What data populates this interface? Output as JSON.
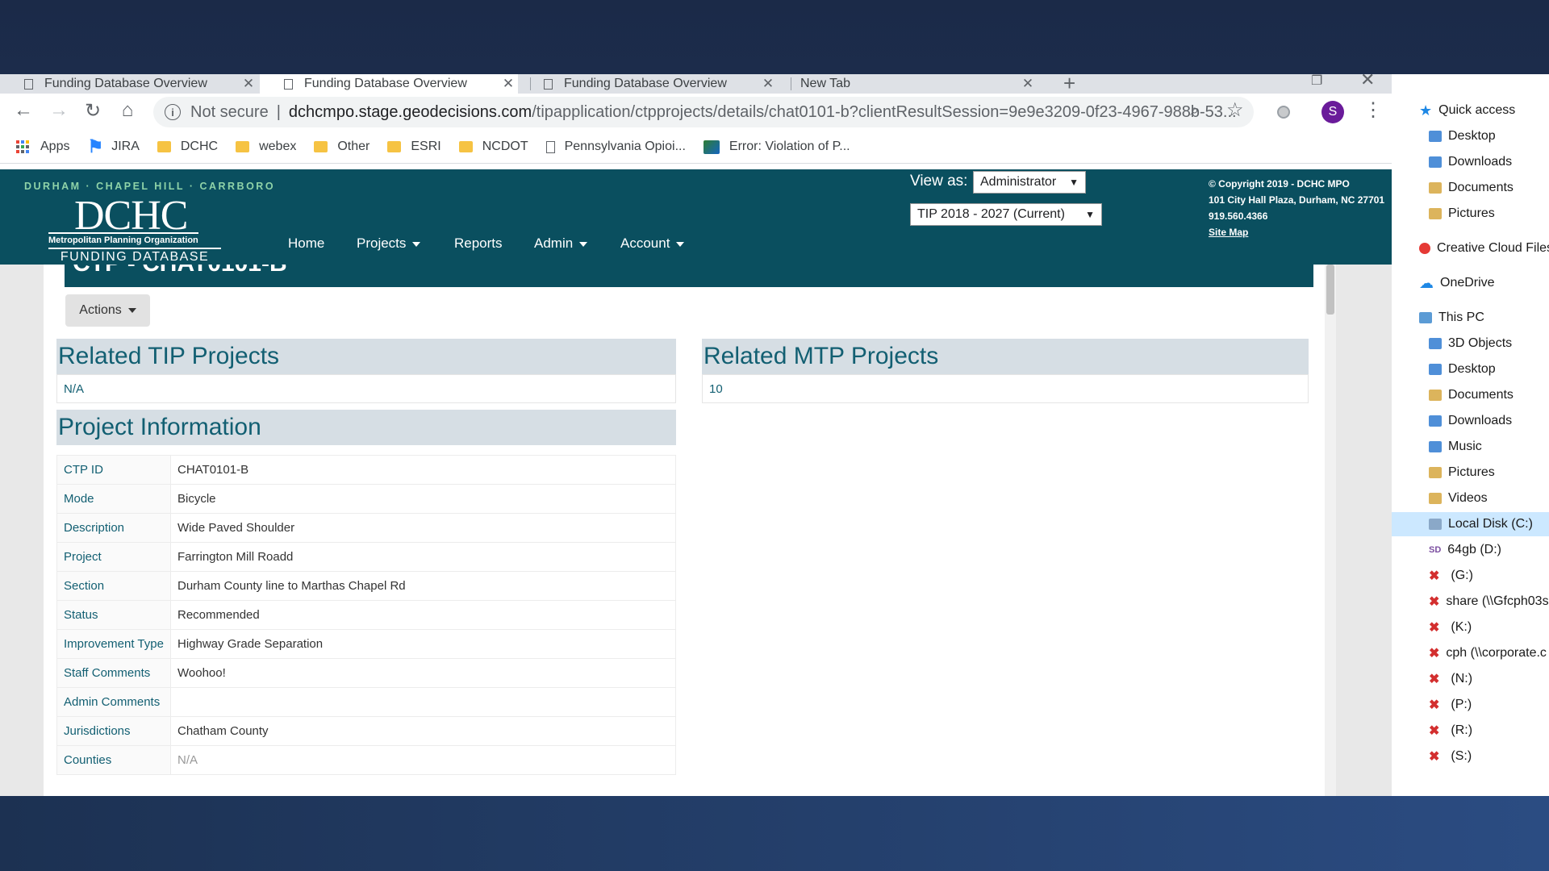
{
  "browser": {
    "tabs": [
      {
        "title": "Funding Database Overview",
        "close": "✕"
      },
      {
        "title": "Funding Database Overview",
        "close": "✕"
      },
      {
        "title": "Funding Database Overview",
        "close": "✕"
      },
      {
        "title": "New Tab",
        "close": "✕"
      }
    ],
    "new_tab": "+",
    "not_secure": "Not secure",
    "url_host": "dchcmpo.stage.geodecisions.com",
    "url_path": "/tipapplication/ctpprojects/details/chat0101-b?clientResultSession=9e9e3209-0f23-4967-988b-53...",
    "profile_initial": "S",
    "bookmarks": [
      {
        "label": "Apps",
        "icon": "apps-icon"
      },
      {
        "label": "JIRA",
        "icon": "jira-icon"
      },
      {
        "label": "DCHC",
        "icon": "folder-icon"
      },
      {
        "label": "webex",
        "icon": "folder-icon"
      },
      {
        "label": "Other",
        "icon": "folder-icon"
      },
      {
        "label": "ESRI",
        "icon": "folder-icon"
      },
      {
        "label": "NCDOT",
        "icon": "folder-icon"
      },
      {
        "label": "Pennsylvania Opioi...",
        "icon": "page-icon"
      },
      {
        "label": "Error: Violation of P...",
        "icon": "map-icon"
      }
    ]
  },
  "site": {
    "tagline": "DURHAM · CHAPEL HILL · CARRBORO",
    "logo": "DCHC",
    "logo_sub": "Metropolitan Planning Organization",
    "logo_title": "FUNDING DATABASE",
    "nav": [
      {
        "label": "Home",
        "dropdown": false
      },
      {
        "label": "Projects",
        "dropdown": true
      },
      {
        "label": "Reports",
        "dropdown": false
      },
      {
        "label": "Admin",
        "dropdown": true
      },
      {
        "label": "Account",
        "dropdown": true
      }
    ],
    "view_as_label": "View as:",
    "view_as_value": "Administrator",
    "tip_value": "TIP 2018 - 2027 (Current)",
    "copyright": "© Copyright 2019 - DCHC MPO",
    "address": "101 City Hall Plaza, Durham, NC 27701",
    "phone": "919.560.4366",
    "site_map": "Site Map"
  },
  "page": {
    "title": "CTP - CHAT0101-B",
    "actions_label": "Actions",
    "related_tip_title": "Related TIP Projects",
    "related_tip_value": "N/A",
    "related_mtp_title": "Related MTP Projects",
    "related_mtp_value": "10",
    "project_info_title": "Project Information",
    "project_info": [
      {
        "key": "CTP ID",
        "value": "CHAT0101-B"
      },
      {
        "key": "Mode",
        "value": "Bicycle"
      },
      {
        "key": "Description",
        "value": "Wide Paved Shoulder"
      },
      {
        "key": "Project",
        "value": "Farrington Mill Roadd"
      },
      {
        "key": "Section",
        "value": "Durham County line to Marthas Chapel Rd"
      },
      {
        "key": "Status",
        "value": "Recommended"
      },
      {
        "key": "Improvement Type",
        "value": "Highway Grade Separation"
      },
      {
        "key": "Staff Comments",
        "value": "Woohoo!"
      },
      {
        "key": "Admin Comments",
        "value": ""
      },
      {
        "key": "Jurisdictions",
        "value": "Chatham County"
      },
      {
        "key": "Counties",
        "value": "N/A"
      }
    ]
  },
  "explorer": {
    "items": [
      {
        "label": "Quick access",
        "icon": "star-icon"
      },
      {
        "label": "Desktop",
        "icon": "folder-icon"
      },
      {
        "label": "Downloads",
        "icon": "folder-icon"
      },
      {
        "label": "Documents",
        "icon": "folder-icon"
      },
      {
        "label": "Pictures",
        "icon": "folder-icon"
      },
      {
        "label": "Creative Cloud Files",
        "icon": "creative-cloud-icon"
      },
      {
        "label": "OneDrive",
        "icon": "cloud-icon"
      },
      {
        "label": "This PC",
        "icon": "pc-icon"
      },
      {
        "label": "3D Objects",
        "icon": "folder-icon"
      },
      {
        "label": "Desktop",
        "icon": "folder-icon"
      },
      {
        "label": "Documents",
        "icon": "folder-icon"
      },
      {
        "label": "Downloads",
        "icon": "folder-icon"
      },
      {
        "label": "Music",
        "icon": "folder-icon"
      },
      {
        "label": "Pictures",
        "icon": "folder-icon"
      },
      {
        "label": "Videos",
        "icon": "folder-icon"
      },
      {
        "label": "Local Disk (C:)",
        "icon": "disk-icon"
      },
      {
        "label": "64gb (D:)",
        "icon": "sd-card-icon"
      },
      {
        "label": "(G:)",
        "icon": "network-drive-disconnected-icon"
      },
      {
        "label": "share (\\\\Gfcph03s",
        "icon": "network-drive-disconnected-icon"
      },
      {
        "label": "(K:)",
        "icon": "network-drive-disconnected-icon"
      },
      {
        "label": "cph (\\\\corporate.c",
        "icon": "network-drive-disconnected-icon"
      },
      {
        "label": "(N:)",
        "icon": "network-drive-disconnected-icon"
      },
      {
        "label": "(P:)",
        "icon": "network-drive-disconnected-icon"
      },
      {
        "label": "(R:)",
        "icon": "network-drive-disconnected-icon"
      },
      {
        "label": "(S:)",
        "icon": "network-drive-disconnected-icon"
      }
    ]
  }
}
